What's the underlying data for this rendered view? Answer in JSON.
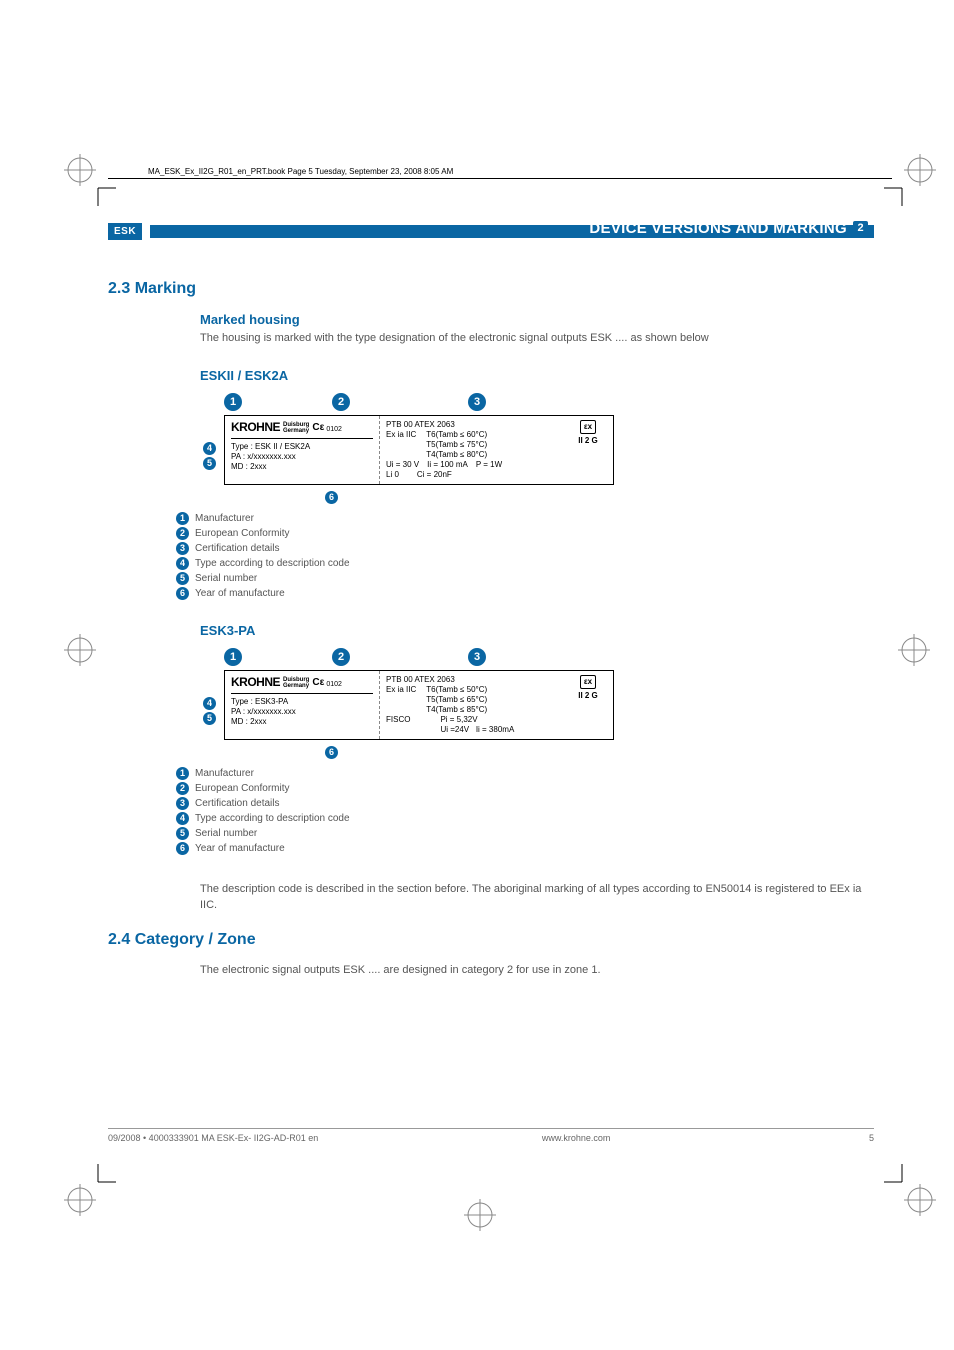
{
  "book_note": "MA_ESK_Ex_II2G_R01_en_PRT.book  Page 5  Tuesday, September 23, 2008  8:05 AM",
  "header": {
    "chip": "ESK",
    "title": "DEVICE VERSIONS AND MARKING",
    "badge": "2"
  },
  "section_2_3": {
    "heading": "2.3  Marking",
    "sub_heading": "Marked housing",
    "body": "The housing is marked with the type designation of the electronic signal outputs ESK .... as shown below"
  },
  "fig1": {
    "title": "ESKII / ESK2A",
    "brand": "KROHNE",
    "brand_sub1": "Duisburg",
    "brand_sub2": "Germany",
    "ce": "C ε",
    "ce_num": "0102",
    "type_line": "Type : ESK II / ESK2A",
    "pa_line": "PA     : x/xxxxxxx.xxx",
    "md_line": "MD   : 2xxx",
    "cert_title": "PTB 00 ATEX 2063",
    "exia": "Ex ia IIC",
    "t6": "T6(Tamb ≤ 60°C)",
    "t5": "T5(Tamb ≤ 75°C)",
    "t4": "T4(Tamb ≤ 80°C)",
    "ui": "Ui = 30 V",
    "ii": "Ii = 100 mA",
    "p": "P = 1W",
    "li": "Li    0",
    "ci": "Ci = 20nF",
    "ex_sym": "εx",
    "ex_cat": "II 2 G",
    "legend": [
      "Manufacturer",
      "European Conformity",
      "Certification details",
      "Type according to description code",
      "Serial number",
      "Year of manufacture"
    ]
  },
  "fig2": {
    "title": "ESK3-PA",
    "brand": "KROHNE",
    "brand_sub1": "Duisburg",
    "brand_sub2": "Germany",
    "ce": "C ε",
    "ce_num": "0102",
    "type_line": "Type : ESK3-PA",
    "pa_line": "PA     : x/xxxxxxx.xxx",
    "md_line": "MD   : 2xxx",
    "cert_title": "PTB 00 ATEX 2063",
    "exia": "Ex ia IIC",
    "t6": "T6(Tamb ≤ 50°C)",
    "t5": "T5(Tamb ≤ 65°C)",
    "t4": "T4(Tamb ≤ 85°C)",
    "fisco": "FISCO",
    "pi": "Pi = 5,32V",
    "ui": "Ui =24V",
    "ii": "Ii = 380mA",
    "ex_sym": "εx",
    "ex_cat": "II 2 G",
    "legend": [
      "Manufacturer",
      "European Conformity",
      "Certification details",
      "Type according to description code",
      "Serial number",
      "Year of manufacture"
    ]
  },
  "desc_para": "The description code is described in the section before. The aboriginal marking of all types according to EN50014 is registered to EEx ia IIC.",
  "section_2_4": {
    "heading": "2.4  Category / Zone",
    "body": "The electronic signal outputs ESK .... are designed in category 2 for use in zone 1."
  },
  "footer": {
    "left": "09/2008 • 4000333901 MA ESK-Ex- II2G-AD-R01 en",
    "mid": "www.krohne.com",
    "page": "5"
  }
}
